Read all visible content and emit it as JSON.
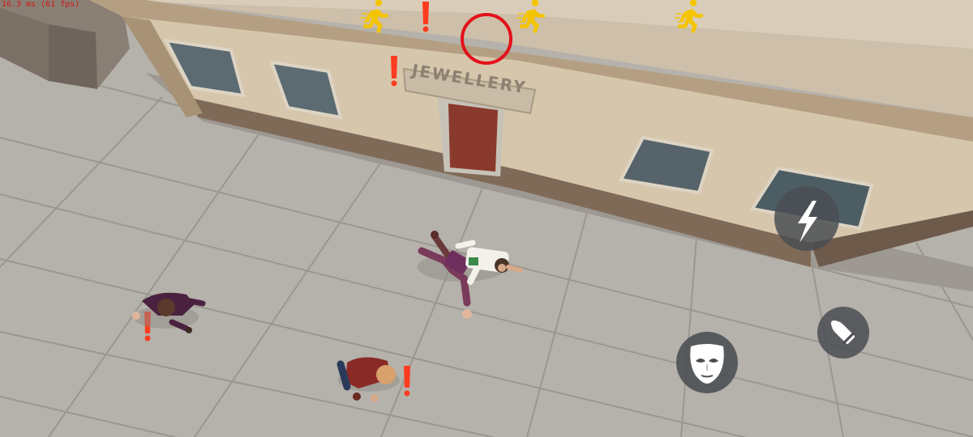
{
  "debug": {
    "frame_time": "16.3 ms (61 fps)"
  },
  "store": {
    "sign_text": "JEWELLERY"
  },
  "alerts": {
    "running_icon": "running-person-icon",
    "alert_icon": "exclamation-icon",
    "target_icon": "target-ring-icon",
    "alert_color": "#ff3b1f",
    "running_color": "#f5c400"
  },
  "hud": {
    "buttons": [
      {
        "id": "sprint",
        "icon": "lightning-bolt-icon"
      },
      {
        "id": "ammo",
        "icon": "bullet-icon"
      },
      {
        "id": "disguise",
        "icon": "mask-icon"
      }
    ],
    "button_color": "#4a4d52"
  },
  "characters": [
    {
      "role": "player",
      "state": "crouching-attack"
    },
    {
      "role": "victim",
      "state": "knocked-down"
    },
    {
      "role": "civilian-purple",
      "state": "cowering-alerted"
    },
    {
      "role": "civilian-red",
      "state": "cowering-alerted"
    }
  ]
}
